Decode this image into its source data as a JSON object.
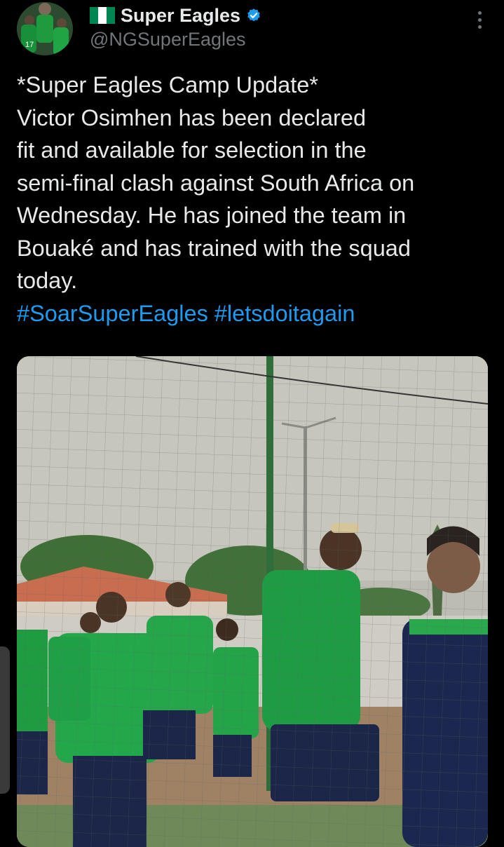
{
  "tweet": {
    "display_name": "Super Eagles",
    "handle": "@NGSuperEagles",
    "text_lines": [
      "*Super Eagles Camp Update*",
      "Victor Osimhen has been declared",
      "fit and available for selection in the",
      "semi-final clash against South Africa on",
      "Wednesday. He has joined the team in",
      "Bouaké and has trained with the squad",
      "today."
    ],
    "hashtags": [
      "#SoarSuperEagles",
      "#letsdoitagain"
    ],
    "avatar_jersey_number": "17"
  },
  "colors": {
    "background": "#000000",
    "text": "#e7e9ea",
    "secondary": "#71767b",
    "link": "#1d9bf0",
    "verified": "#1d9bf0",
    "flag_green": "#008751"
  },
  "icons": {
    "flag": "nigeria-flag-icon",
    "verified": "verified-badge-icon",
    "more": "more-options-icon"
  }
}
